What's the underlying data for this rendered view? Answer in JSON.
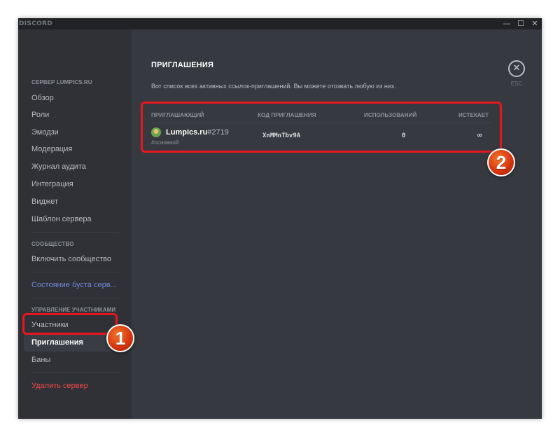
{
  "window": {
    "brand": "DISCORD",
    "minimize_glyph": "—",
    "maximize_glyph": "☐",
    "close_glyph": "✕"
  },
  "sidebar": {
    "server_header": "СЕРВЕР LUMPICS.RU",
    "server_items": [
      "Обзор",
      "Роли",
      "Эмодзи",
      "Модерация",
      "Журнал аудита",
      "Интеграция",
      "Виджет",
      "Шаблон сервера"
    ],
    "community_header": "СООБЩЕСТВО",
    "community_items": [
      "Включить сообщество"
    ],
    "boost_item": "Состояние буста серв...",
    "members_header": "УПРАВЛЕНИЕ УЧАСТНИКАМИ",
    "members_items": [
      "Участники",
      "Приглашения",
      "Баны"
    ],
    "active_item": "Приглашения",
    "delete_item": "Удалить сервер"
  },
  "main": {
    "title": "ПРИГЛАШЕНИЯ",
    "description": "Вот список всех активных ссылок-приглашений. Вы можете отозвать любую из них.",
    "close_glyph": "✕",
    "esc_label": "ESC",
    "table": {
      "headers": [
        "ПРИГЛАШАЮЩИЙ",
        "КОД ПРИГЛАШЕНИЯ",
        "ИСПОЛЬЗОВАНИЙ",
        "ИСТЕКАЕТ"
      ],
      "rows": [
        {
          "inviter_name": "Lumpics.ru",
          "inviter_tag": "#2719",
          "channel": "#основной",
          "code": "XnMMnTbv9A",
          "uses": "0",
          "expires": "∞"
        }
      ]
    }
  },
  "annotations": {
    "badge_1": "1",
    "badge_2": "2",
    "highlight_color": "#e8161f",
    "badge_color": "#d9360f"
  },
  "colors": {
    "sidebar_bg": "#2f3136",
    "content_bg": "#36393f",
    "titlebar_bg": "#202225",
    "boost_accent": "#7289da",
    "danger": "#f04747"
  }
}
